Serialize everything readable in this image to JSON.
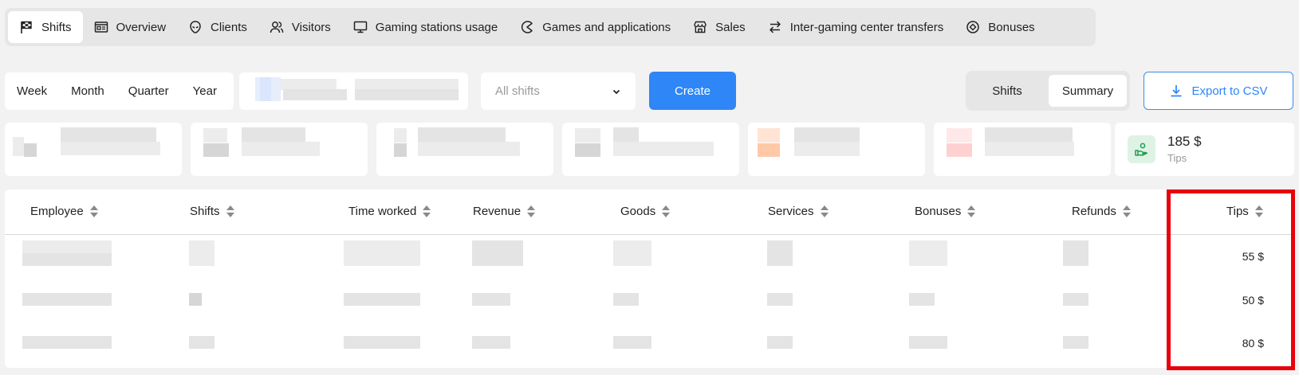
{
  "nav": {
    "tabs": [
      {
        "label": "Shifts",
        "icon": "checkered-flag-icon",
        "active": true
      },
      {
        "label": "Overview",
        "icon": "dashboard-card-icon"
      },
      {
        "label": "Clients",
        "icon": "alien-head-icon"
      },
      {
        "label": "Visitors",
        "icon": "users-icon"
      },
      {
        "label": "Gaming stations usage",
        "icon": "monitor-icon"
      },
      {
        "label": "Games and applications",
        "icon": "pacman-icon"
      },
      {
        "label": "Sales",
        "icon": "store-icon"
      },
      {
        "label": "Inter-gaming center transfers",
        "icon": "transfer-arrows-icon"
      },
      {
        "label": "Bonuses",
        "icon": "bonus-badge-icon"
      }
    ]
  },
  "period": {
    "options": [
      "Week",
      "Month",
      "Quarter",
      "Year"
    ]
  },
  "filter": {
    "shift_placeholder": "All shifts"
  },
  "actions": {
    "create_label": "Create",
    "view_shifts_label": "Shifts",
    "view_summary_label": "Summary",
    "export_label": "Export to CSV"
  },
  "stats": {
    "tips_value": "185 $",
    "tips_label": "Tips"
  },
  "table": {
    "columns": [
      "Employee",
      "Shifts",
      "Time worked",
      "Revenue",
      "Goods",
      "Services",
      "Bonuses",
      "Refunds",
      "Tips"
    ],
    "tips": [
      "55 $",
      "50 $",
      "80 $"
    ]
  },
  "colors": {
    "accent": "#2f86f6",
    "highlight": "#e8000b",
    "tips_icon_bg": "#def3e4"
  }
}
